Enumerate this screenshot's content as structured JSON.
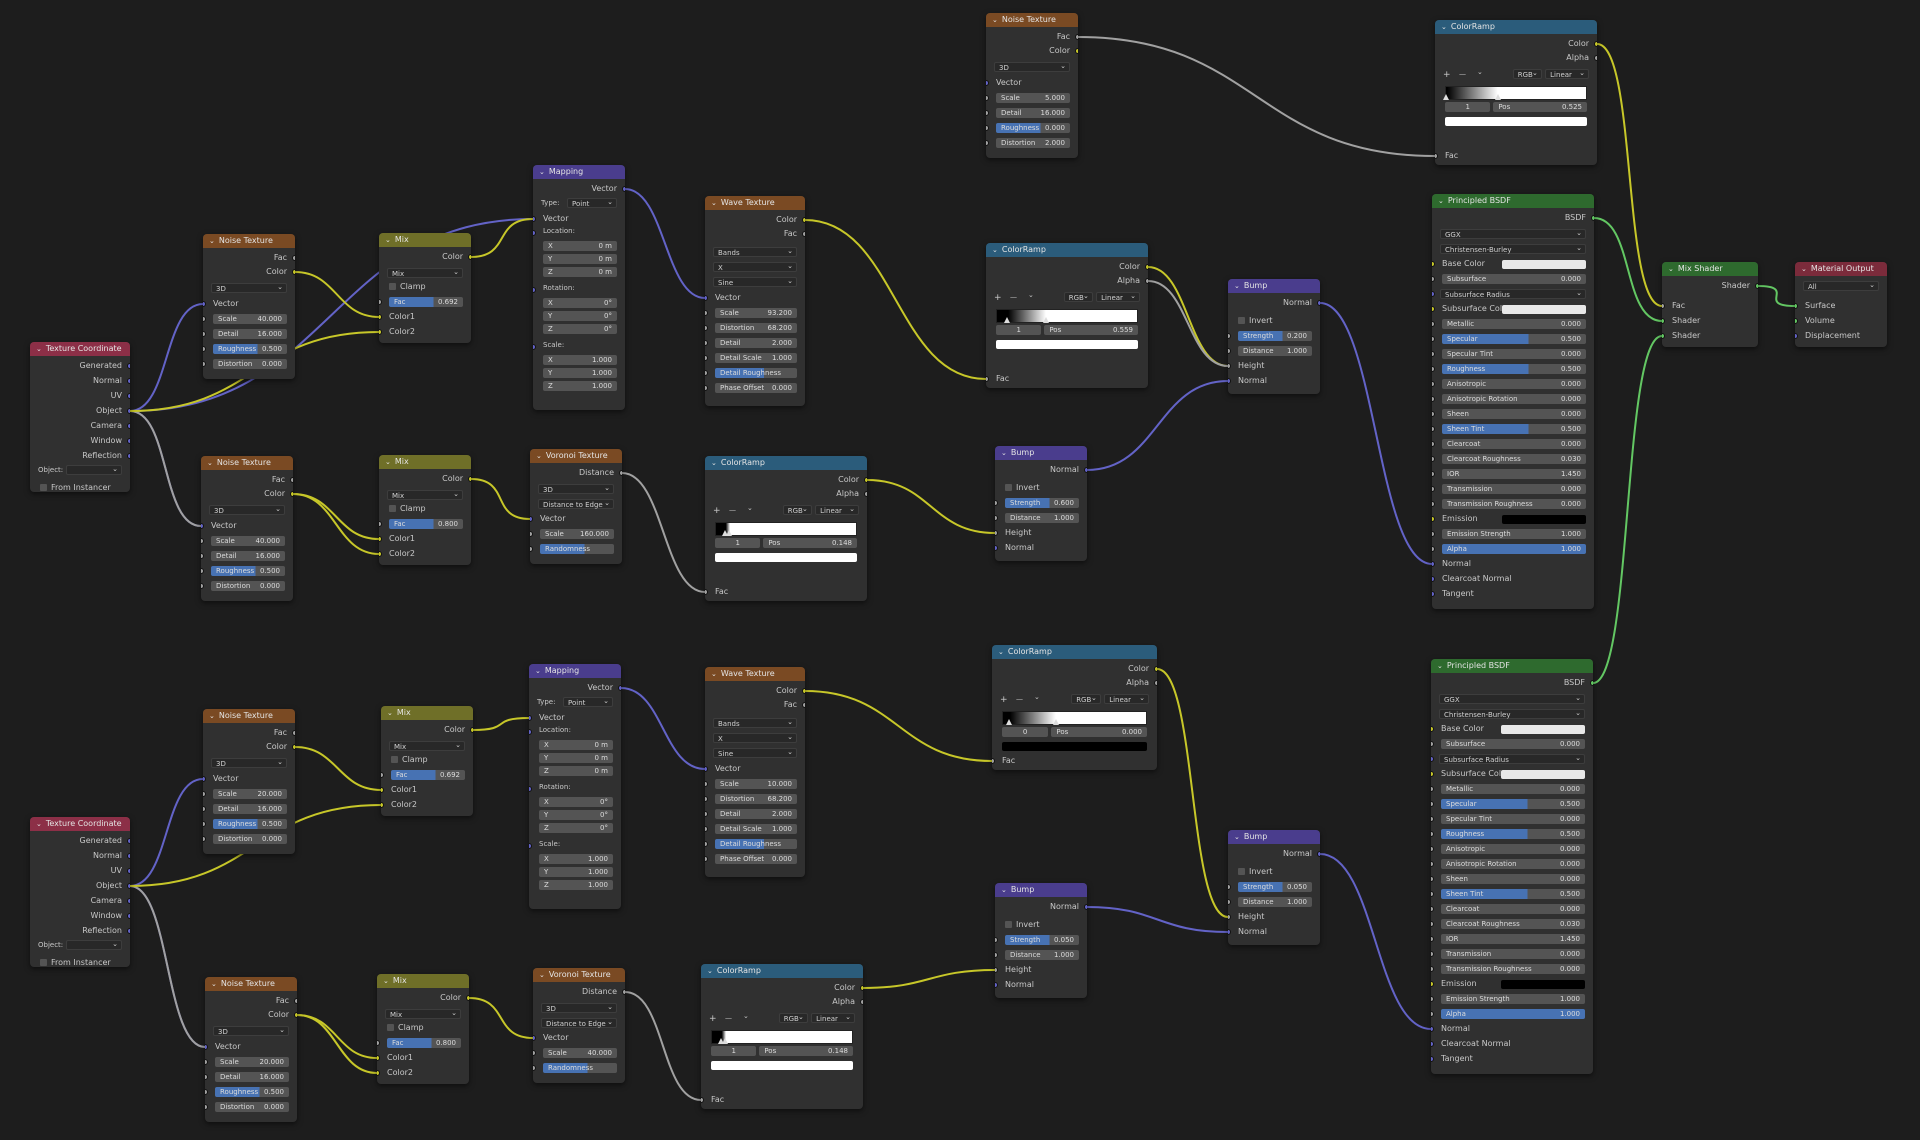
{
  "colors": {
    "texture": "#7a4a23",
    "converter": "#2b5c7b",
    "vector": "#4a3d8d",
    "color": "#6f6f28",
    "shader": "#2e6a2e",
    "input": "#8c2f47",
    "output": "#7b2b3b",
    "wire_gray": "#a1a1a1",
    "wire_yellow": "#c7c729",
    "wire_purple": "#6363c7",
    "wire_green": "#63c763"
  },
  "common": {
    "chevron": "⌄",
    "plus": "+",
    "minus": "—",
    "dd": "⌄"
  },
  "texcoord": {
    "title": "Texture Coordinate",
    "outputs": [
      "Generated",
      "Normal",
      "UV",
      "Object",
      "Camera",
      "Window",
      "Reflection"
    ],
    "object_label": "Object:",
    "from_instancer": "From Instancer"
  },
  "noise": {
    "title": "Noise Texture",
    "fac": "Fac",
    "color": "Color",
    "dim": "3D",
    "vector": "Vector",
    "scale": "Scale",
    "detail": "Detail",
    "roughness": "Roughness",
    "distortion": "Distortion"
  },
  "noise_a": {
    "scale": "40.000",
    "detail": "16.000",
    "rough": "0.500",
    "dist": "0.000"
  },
  "noise_b": {
    "scale": "40.000",
    "detail": "16.000",
    "rough": "0.500",
    "dist": "0.000"
  },
  "noise_c": {
    "scale": "20.000",
    "detail": "16.000",
    "rough": "0.500",
    "dist": "0.000"
  },
  "noise_d": {
    "scale": "20.000",
    "detail": "16.000",
    "rough": "0.500",
    "dist": "0.000"
  },
  "noise_top": {
    "scale": "5.000",
    "detail": "16.000",
    "rough": "0.000",
    "dist": "2.000"
  },
  "mix": {
    "title": "Mix",
    "color": "Color",
    "mode": "Mix",
    "clamp": "Clamp",
    "fac": "Fac",
    "color1": "Color1",
    "color2": "Color2"
  },
  "mix_a": {
    "fac": "0.692"
  },
  "mix_b": {
    "fac": "0.800"
  },
  "mix_c": {
    "fac": "0.692"
  },
  "mix_d": {
    "fac": "0.800"
  },
  "mapping": {
    "title": "Mapping",
    "vector_out": "Vector",
    "type_label": "Type:",
    "type": "Point",
    "vector": "Vector",
    "location": "Location:",
    "rotation": "Rotation:",
    "scale": "Scale:",
    "x": "X",
    "y": "Y",
    "z": "Z",
    "loc_val": "0 m",
    "rot_val": "0°",
    "scale_val": "1.000"
  },
  "voronoi": {
    "title": "Voronoi Texture",
    "distance": "Distance",
    "dim": "3D",
    "mode": "Distance to Edge",
    "vector": "Vector",
    "scale": "Scale",
    "randomness": "Randomness"
  },
  "voronoi_a": {
    "scale": "160.000",
    "rand": "1.000"
  },
  "voronoi_b": {
    "scale": "40.000",
    "rand": "1.000"
  },
  "wave": {
    "title": "Wave Texture",
    "color": "Color",
    "fac": "Fac",
    "type": "Bands",
    "dir": "X",
    "profile": "Sine",
    "vector": "Vector",
    "scale": "Scale",
    "distortion": "Distortion",
    "detail": "Detail",
    "detail_scale": "Detail Scale",
    "detail_rough": "Detail Roughness",
    "phase": "Phase Offset"
  },
  "wave_a": {
    "scale": "93.200",
    "dist": "68.200",
    "detail": "2.000",
    "dscale": "1.000",
    "drough": "0.500",
    "phase": "0.000"
  },
  "wave_b": {
    "scale": "10.000",
    "dist": "68.200",
    "detail": "2.000",
    "dscale": "1.000",
    "drough": "0.500",
    "phase": "0.000"
  },
  "ramp": {
    "title": "ColorRamp",
    "color": "Color",
    "alpha": "Alpha",
    "mode": "RGB",
    "interp": "Linear",
    "fac": "Fac",
    "pos": "Pos"
  },
  "ramp_top": {
    "index": "1",
    "pos": "0.525"
  },
  "ramp_mid": {
    "index": "1",
    "pos": "0.559"
  },
  "ramp_a": {
    "index": "1",
    "pos": "0.148"
  },
  "ramp_b": {
    "index": "0",
    "pos": "0.000"
  },
  "ramp_c": {
    "index": "1",
    "pos": "0.148"
  },
  "bump": {
    "title": "Bump",
    "normal_out": "Normal",
    "invert": "Invert",
    "strength": "Strength",
    "distance": "Distance",
    "height": "Height",
    "normal": "Normal"
  },
  "bump_a": {
    "strength": "0.600",
    "distance": "1.000"
  },
  "bump_b": {
    "strength": "0.200",
    "distance": "1.000"
  },
  "bump_c": {
    "strength": "0.050",
    "distance": "1.000"
  },
  "bump_d": {
    "strength": "0.050",
    "distance": "1.000"
  },
  "bsdf": {
    "title": "Principled BSDF",
    "out": "BSDF",
    "dist": "GGX",
    "sss": "Christensen-Burley",
    "base_color": "Base Color",
    "subsurface": "Subsurface",
    "sss_radius": "Subsurface Radius",
    "sss_col": "Subsurface Col",
    "metallic": "Metallic",
    "specular": "Specular",
    "spec_tint": "Specular Tint",
    "roughness": "Roughness",
    "aniso": "Anisotropic",
    "aniso_rot": "Anisotropic Rotation",
    "sheen": "Sheen",
    "sheen_tint": "Sheen Tint",
    "clearcoat": "Clearcoat",
    "cc_rough": "Clearcoat Roughness",
    "ior": "IOR",
    "transmission": "Transmission",
    "trans_rough": "Transmission Roughness",
    "emission": "Emission",
    "emission_strength": "Emission Strength",
    "alpha": "Alpha",
    "normal": "Normal",
    "cc_normal": "Clearcoat Normal",
    "tangent": "Tangent",
    "vals": {
      "subsurface": "0.000",
      "metallic": "0.000",
      "specular": "0.500",
      "spec_tint": "0.000",
      "roughness": "0.500",
      "aniso": "0.000",
      "aniso_rot": "0.000",
      "sheen": "0.000",
      "sheen_tint": "0.500",
      "clearcoat": "0.000",
      "cc_rough": "0.030",
      "ior": "1.450",
      "transmission": "0.000",
      "trans_rough": "0.000",
      "emission_strength": "1.000",
      "alpha": "1.000"
    }
  },
  "mixshader": {
    "title": "Mix Shader",
    "shader_out": "Shader",
    "fac": "Fac",
    "shader": "Shader"
  },
  "matout": {
    "title": "Material Output",
    "target": "All",
    "surface": "Surface",
    "volume": "Volume",
    "displacement": "Displacement"
  }
}
